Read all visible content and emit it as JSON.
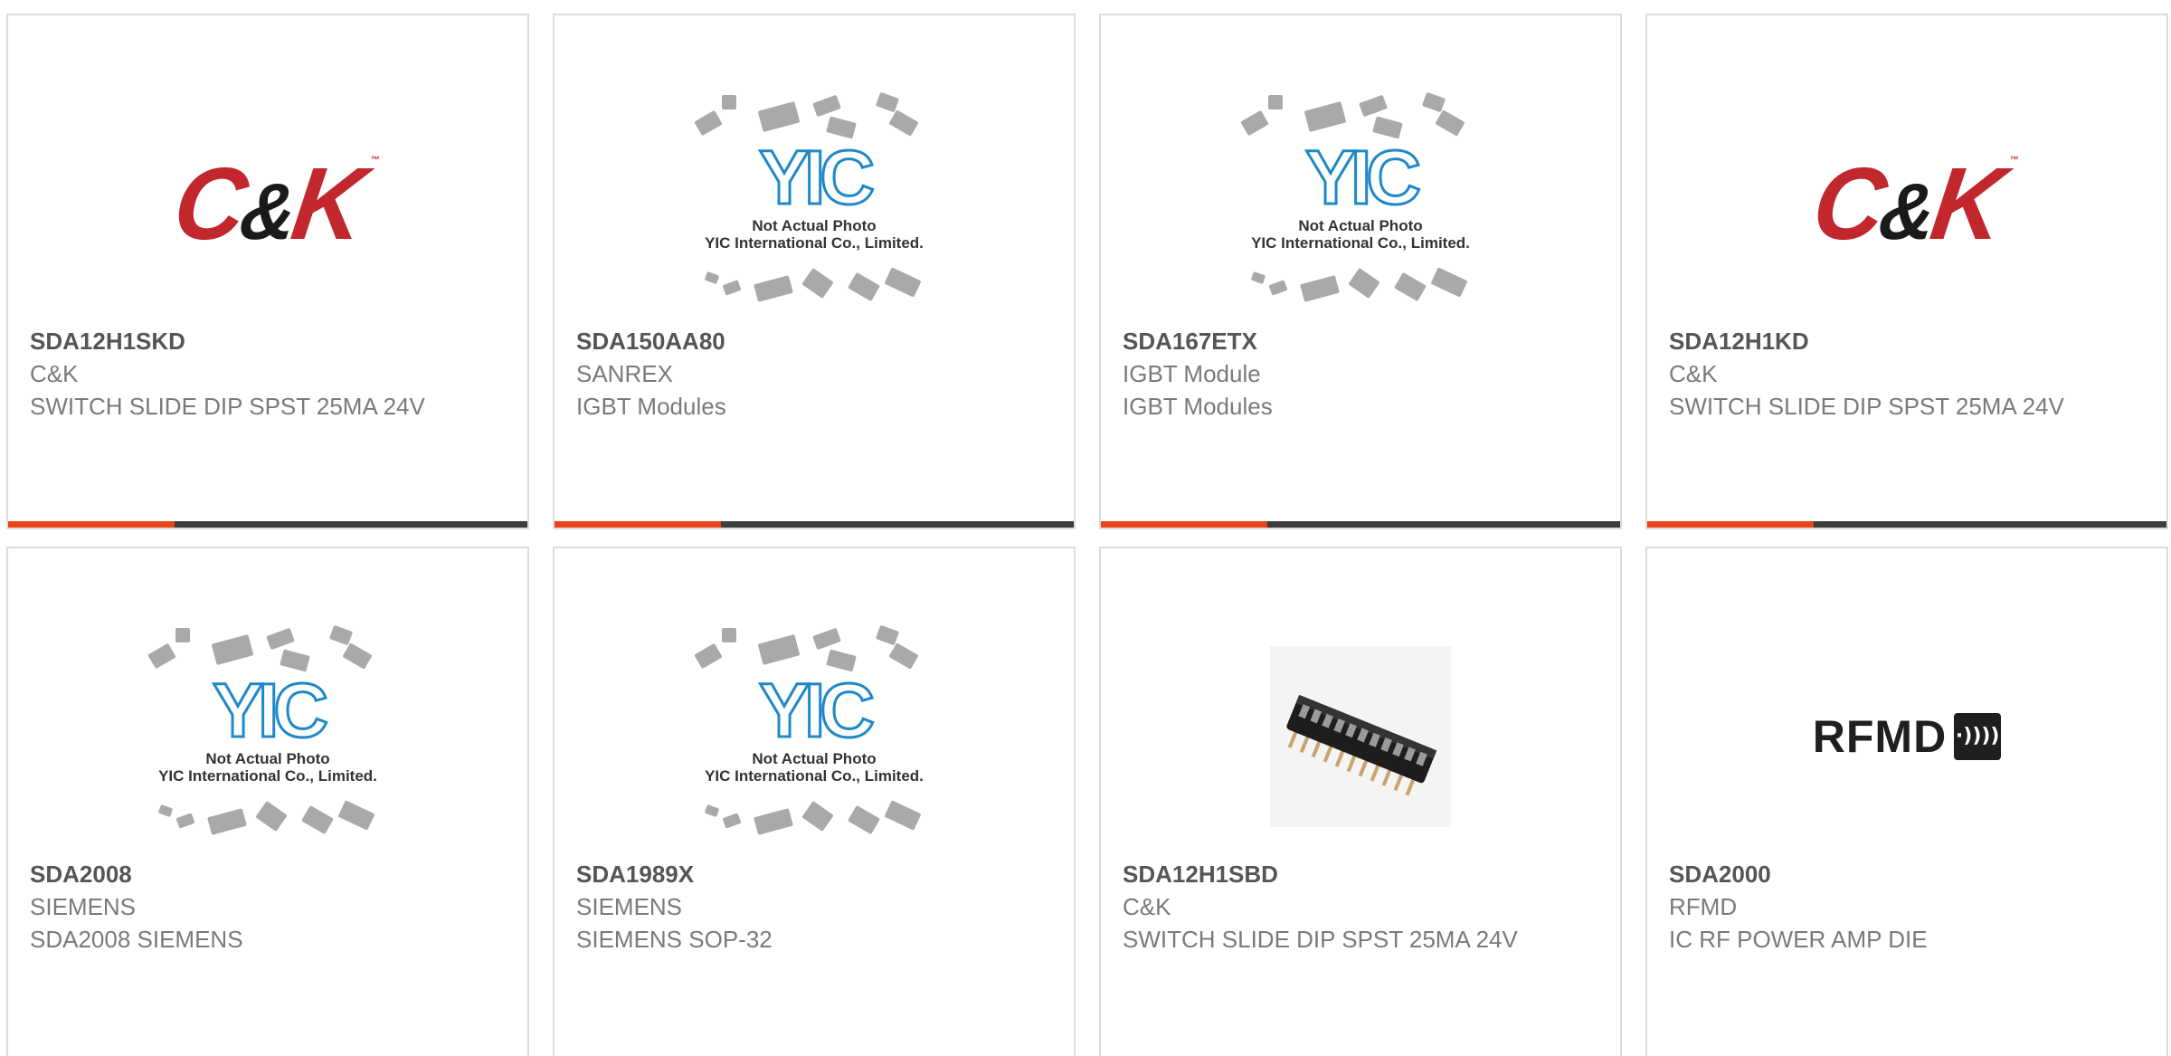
{
  "products": [
    {
      "part_number": "SDA12H1SKD",
      "manufacturer": "C&K",
      "description": "SWITCH SLIDE DIP SPST 25MA 24V",
      "image": "ck-logo",
      "progress": 0.32
    },
    {
      "part_number": "SDA150AA80",
      "manufacturer": "SANREX",
      "description": "IGBT Modules",
      "image": "yic-placeholder",
      "progress": 0.32
    },
    {
      "part_number": "SDA167ETX",
      "manufacturer": "IGBT Module",
      "description": "IGBT Modules",
      "image": "yic-placeholder",
      "progress": 0.32
    },
    {
      "part_number": "SDA12H1KD",
      "manufacturer": "C&K",
      "description": "SWITCH SLIDE DIP SPST 25MA 24V",
      "image": "ck-logo",
      "progress": 0.32
    },
    {
      "part_number": "SDA2008",
      "manufacturer": "SIEMENS",
      "description": "SDA2008 SIEMENS",
      "image": "yic-placeholder"
    },
    {
      "part_number": "SDA1989X",
      "manufacturer": "SIEMENS",
      "description": "SIEMENS SOP-32",
      "image": "yic-placeholder"
    },
    {
      "part_number": "SDA12H1SBD",
      "manufacturer": "C&K",
      "description": "SWITCH SLIDE DIP SPST 25MA 24V",
      "image": "dip-switch-photo"
    },
    {
      "part_number": "SDA2000",
      "manufacturer": "RFMD",
      "description": "IC RF POWER AMP DIE",
      "image": "rfmd-logo"
    }
  ],
  "logos": {
    "ck": {
      "c": "C",
      "amp": "&",
      "k": "K",
      "tm": "™"
    },
    "rfmd": {
      "text": "RFMD",
      "mark": "·))))"
    },
    "yic": {
      "brand": "YIC",
      "line1": "Not Actual Photo",
      "line2": "YIC International Co., Limited."
    }
  },
  "colors": {
    "accent": "#e8441a",
    "progress_track": "#3c3c3c",
    "ck_red": "#c1272d",
    "yic_blue": "#1e88c8",
    "border": "#dcdcdc"
  }
}
